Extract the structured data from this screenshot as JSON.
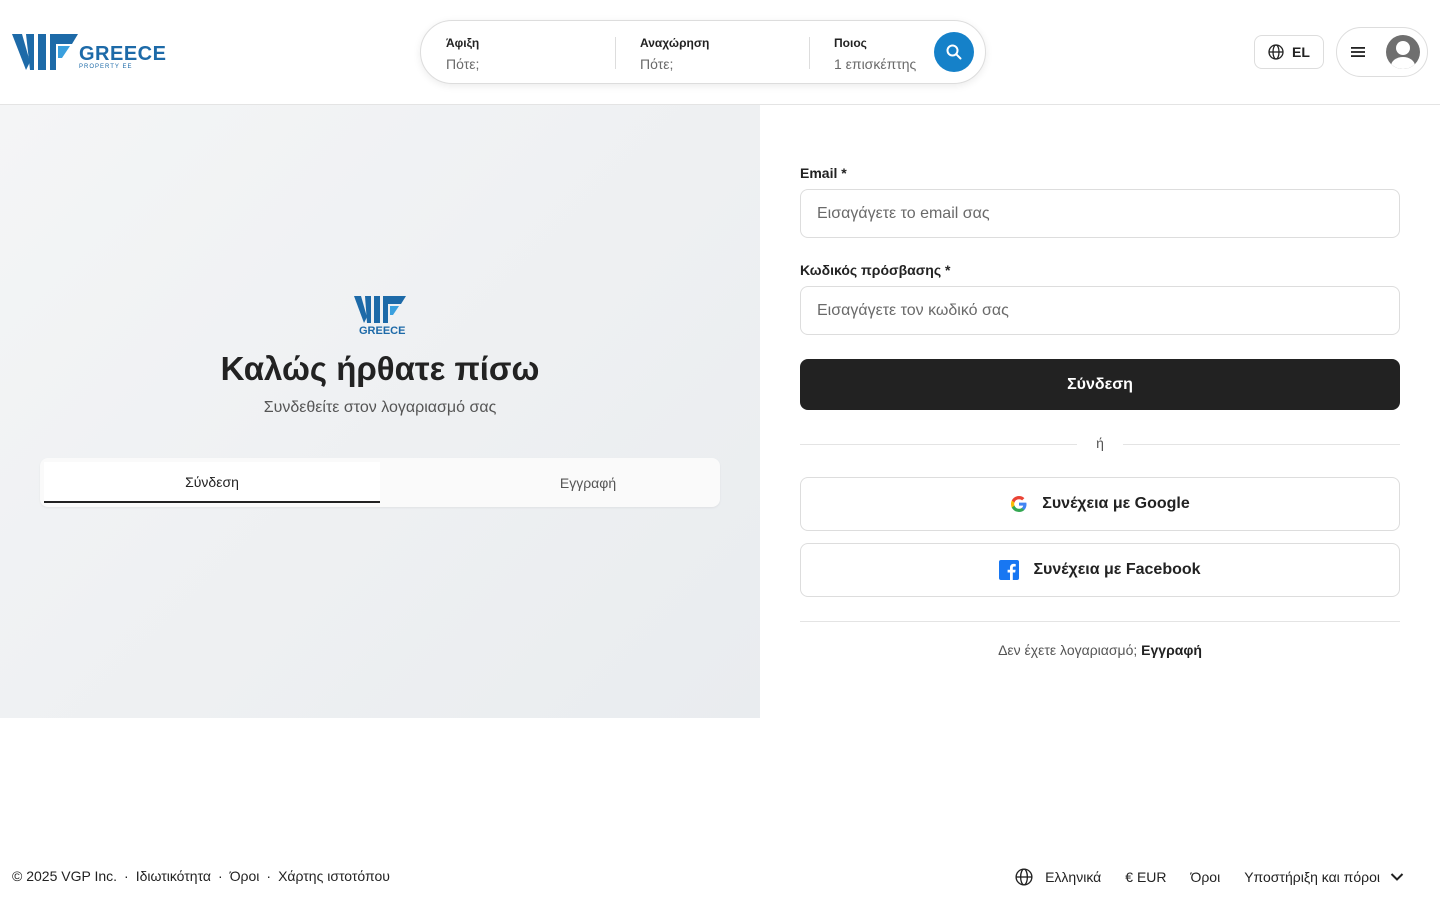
{
  "header": {
    "logo": {
      "brand": "GREECE",
      "tagline": "PROPERTY EE"
    },
    "search": {
      "arrival_label": "Άφιξη",
      "arrival_value": "Πότε;",
      "departure_label": "Αναχώρηση",
      "departure_value": "Πότε;",
      "guests_label": "Ποιος",
      "guests_value": "1 επισκέπτης"
    },
    "language_code": "EL"
  },
  "left": {
    "logo_brand": "GREECE",
    "title": "Καλώς ήρθατε πίσω",
    "subtitle": "Συνδεθείτε στον λογαριασμό σας",
    "tabs": [
      {
        "label": "Σύνδεση",
        "active": true
      },
      {
        "label": "Εγγραφή",
        "active": false
      }
    ]
  },
  "form": {
    "email_label": "Email *",
    "email_placeholder": "Εισαγάγετε το email σας",
    "password_label": "Κωδικός πρόσβασης *",
    "password_placeholder": "Εισαγάγετε τον κωδικό σας",
    "submit_label": "Σύνδεση",
    "or_text": "ή",
    "google_label": "Συνέχεια με Google",
    "facebook_label": "Συνέχεια με Facebook",
    "no_account_text": "Δεν έχετε λογαριασμό;",
    "signup_link": "Εγγραφή"
  },
  "footer": {
    "copyright": "© 2025 VGP Inc.",
    "links": [
      "Ιδιωτικότητα",
      "Όροι",
      "Χάρτης ιστοτόπου"
    ],
    "language": "Ελληνικά",
    "currency": "€ EUR",
    "terms": "Όροι",
    "support": "Υποστήριξη και πόροι"
  },
  "colors": {
    "accent": "#1581c9",
    "brand_blue": "#1d6aa8",
    "primary_button": "#222222",
    "facebook": "#1877f2"
  },
  "icons": [
    "search-icon",
    "globe-icon",
    "menu-icon",
    "user-avatar-icon",
    "google-icon",
    "facebook-icon",
    "chevron-down-icon"
  ]
}
